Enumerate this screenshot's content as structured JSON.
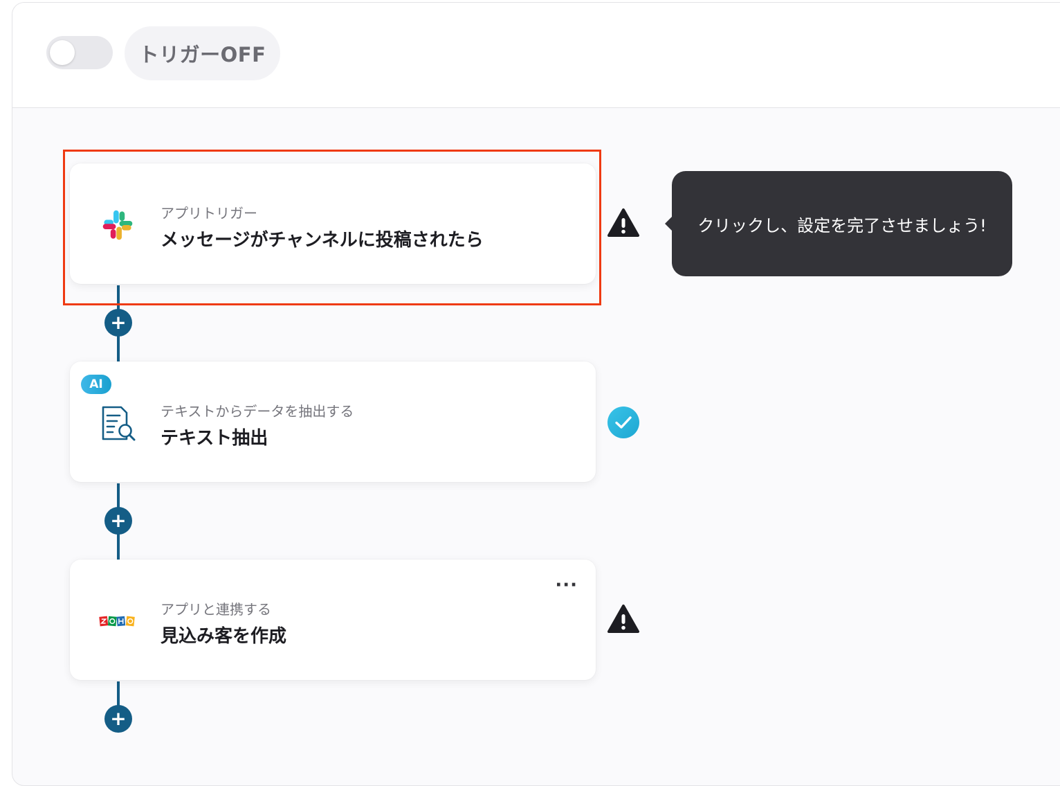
{
  "header": {
    "trigger_toggle_state": "off",
    "trigger_label": "トリガーOFF"
  },
  "steps": [
    {
      "kind": "app-trigger",
      "icon": "slack-icon",
      "subtitle": "アプリトリガー",
      "title": "メッセージがチャンネルに投稿されたら",
      "status": "warning",
      "highlighted": true
    },
    {
      "kind": "ai-operation",
      "badge": "AI",
      "icon": "document-search-icon",
      "subtitle": "テキストからデータを抽出する",
      "title": "テキスト抽出",
      "status": "complete"
    },
    {
      "kind": "app-action",
      "icon": "zoho-logo-icon",
      "subtitle": "アプリと連携する",
      "title": "見込み客を作成",
      "status": "warning",
      "menu_label": "···"
    }
  ],
  "tooltip": {
    "text": "クリックし、設定を完了させましょう!"
  },
  "add_button_label": "+",
  "colors": {
    "connector": "#145d86",
    "highlight": "#ef3a12",
    "check": "#2bb3dc",
    "warning": "#1d1d22",
    "tooltip_bg": "#333338"
  }
}
